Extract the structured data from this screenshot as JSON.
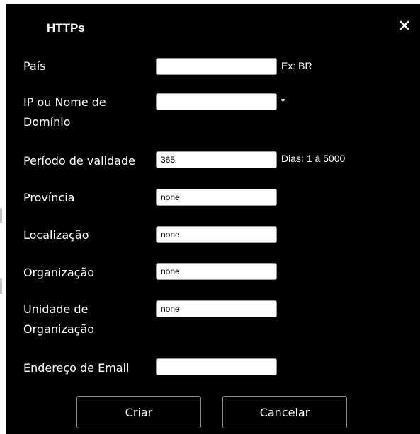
{
  "dialog": {
    "title": "HTTPs",
    "close_icon": "close-icon"
  },
  "fields": {
    "country": {
      "label": "País",
      "value": "",
      "hint": "Ex: BR"
    },
    "domain": {
      "label_line1": "IP ou Nome de",
      "label_line2": "Domínio",
      "value": "",
      "hint": "*"
    },
    "validity": {
      "label": "Período de validade",
      "value": "365",
      "hint": "Dias: 1 à 5000"
    },
    "province": {
      "label": "Província",
      "value": "none"
    },
    "location": {
      "label": "Localização",
      "value": "none"
    },
    "organization": {
      "label": "Organização",
      "value": "none"
    },
    "unit": {
      "label_line1": "Unidade de",
      "label_line2": "Organização",
      "value": "none"
    },
    "email": {
      "label": "Endereço de Email",
      "value": ""
    }
  },
  "buttons": {
    "create": "Criar",
    "cancel": "Cancelar"
  }
}
